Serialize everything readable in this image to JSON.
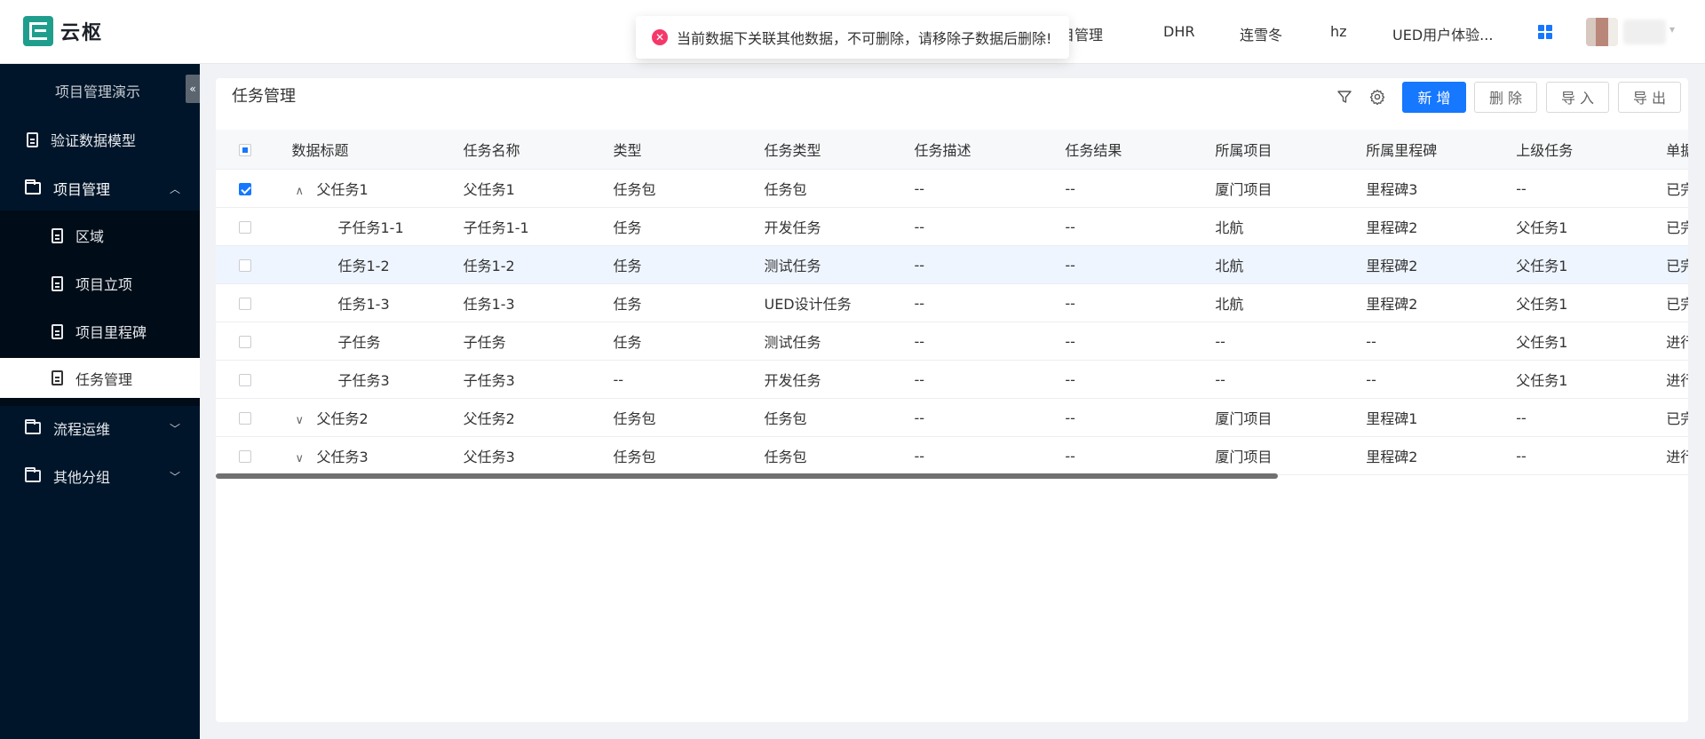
{
  "app": {
    "name": "云枢"
  },
  "top_nav": {
    "items": [
      "目管理",
      "DHR",
      "连雪冬",
      "hz",
      "UED用户体验..."
    ]
  },
  "toast": {
    "message": "当前数据下关联其他数据，不可删除，请移除子数据后删除!"
  },
  "sidebar": {
    "title": "项目管理演示",
    "collapse_glyph": "«",
    "items": [
      {
        "label": "验证数据模型"
      },
      {
        "label": "项目管理",
        "expanded": true
      },
      {
        "label": "区域"
      },
      {
        "label": "项目立项"
      },
      {
        "label": "项目里程碑"
      },
      {
        "label": "任务管理",
        "active": true
      },
      {
        "label": "流程运维"
      },
      {
        "label": "其他分组"
      }
    ]
  },
  "page": {
    "title": "任务管理",
    "buttons": {
      "add": "新 增",
      "delete": "删 除",
      "import": "导 入",
      "export": "导 出"
    }
  },
  "table": {
    "columns": [
      "数据标题",
      "任务名称",
      "类型",
      "任务类型",
      "任务描述",
      "任务结果",
      "所属项目",
      "所属里程碑",
      "上级任务",
      "单据"
    ],
    "rows": [
      {
        "checked": true,
        "toggle": "∧",
        "indent": 0,
        "cells": [
          "父任务1",
          "父任务1",
          "任务包",
          "任务包",
          "--",
          "--",
          "厦门项目",
          "里程碑3",
          "--",
          "已完"
        ]
      },
      {
        "checked": false,
        "toggle": "",
        "indent": 1,
        "cells": [
          "子任务1-1",
          "子任务1-1",
          "任务",
          "开发任务",
          "--",
          "--",
          "北航",
          "里程碑2",
          "父任务1",
          "已完"
        ]
      },
      {
        "checked": false,
        "toggle": "",
        "indent": 1,
        "highlight": true,
        "cells": [
          "任务1-2",
          "任务1-2",
          "任务",
          "测试任务",
          "--",
          "--",
          "北航",
          "里程碑2",
          "父任务1",
          "已完"
        ]
      },
      {
        "checked": false,
        "toggle": "",
        "indent": 1,
        "cells": [
          "任务1-3",
          "任务1-3",
          "任务",
          "UED设计任务",
          "--",
          "--",
          "北航",
          "里程碑2",
          "父任务1",
          "已完"
        ]
      },
      {
        "checked": false,
        "toggle": "",
        "indent": 1,
        "cells": [
          "子任务",
          "子任务",
          "任务",
          "测试任务",
          "--",
          "--",
          "--",
          "--",
          "父任务1",
          "进行"
        ]
      },
      {
        "checked": false,
        "toggle": "",
        "indent": 1,
        "cells": [
          "子任务3",
          "子任务3",
          "--",
          "开发任务",
          "--",
          "--",
          "--",
          "--",
          "父任务1",
          "进行"
        ]
      },
      {
        "checked": false,
        "toggle": "∨",
        "indent": 0,
        "cells": [
          "父任务2",
          "父任务2",
          "任务包",
          "任务包",
          "--",
          "--",
          "厦门项目",
          "里程碑1",
          "--",
          "已完"
        ]
      },
      {
        "checked": false,
        "toggle": "∨",
        "indent": 0,
        "cells": [
          "父任务3",
          "父任务3",
          "任务包",
          "任务包",
          "--",
          "--",
          "厦门项目",
          "里程碑2",
          "--",
          "进行"
        ]
      }
    ]
  },
  "colors": {
    "accent": "#1677ff",
    "sidebar_bg": "#001529",
    "error": "#f5386a"
  }
}
